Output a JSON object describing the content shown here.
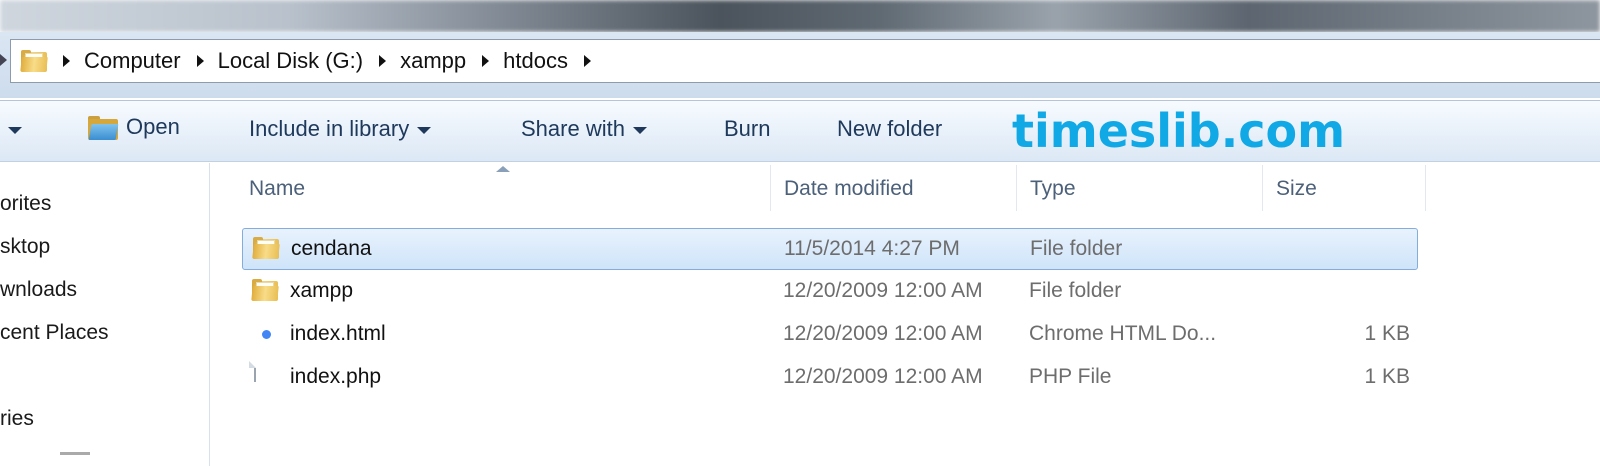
{
  "address": {
    "crumbs": [
      "Computer",
      "Local Disk (G:)",
      "xampp",
      "htdocs"
    ]
  },
  "toolbar": {
    "open_label": "Open",
    "include_label": "Include in library",
    "share_label": "Share with",
    "burn_label": "Burn",
    "new_folder_label": "New folder"
  },
  "watermark": "timeslib.com",
  "navigation": {
    "items": [
      "orites",
      "sktop",
      "wnloads",
      "cent Places",
      "ries"
    ]
  },
  "columns": {
    "name": "Name",
    "date": "Date modified",
    "type": "Type",
    "size": "Size"
  },
  "files": [
    {
      "name": "cendana",
      "date": "11/5/2014 4:27 PM",
      "type": "File folder",
      "size": "",
      "icon": "folder-icon",
      "selected": true
    },
    {
      "name": "xampp",
      "date": "12/20/2009 12:00 AM",
      "type": "File folder",
      "size": "",
      "icon": "folder-icon",
      "selected": false
    },
    {
      "name": "index.html",
      "date": "12/20/2009 12:00 AM",
      "type": "Chrome HTML Do...",
      "size": "1 KB",
      "icon": "chrome-icon",
      "selected": false
    },
    {
      "name": "index.php",
      "date": "12/20/2009 12:00 AM",
      "type": "PHP File",
      "size": "1 KB",
      "icon": "file-icon",
      "selected": false
    }
  ],
  "colors": {
    "watermark": "#11a8e6",
    "selection_border": "#84acdd",
    "toolbar_text": "#1e395b"
  }
}
